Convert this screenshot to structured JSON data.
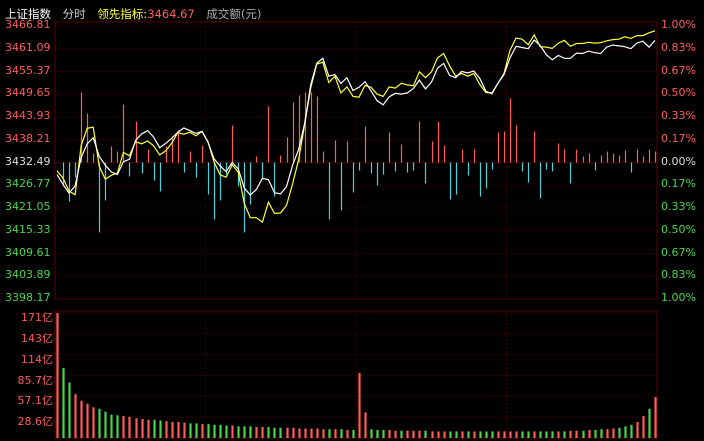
{
  "header": {
    "index_name": "上证指数",
    "period": "分时",
    "leading_index_label": "领先指标:",
    "leading_index_value": "3464.67",
    "volume_label": "成交额(元)"
  },
  "colors": {
    "background": "#000000",
    "up": "#ff5b5b",
    "down": "#4ad0d6",
    "even": "#dddddd",
    "green_pct": "#4bd44b",
    "price_line": "#ffffff",
    "leading_line": "#ffff33",
    "grid": "#3a0000"
  },
  "price_axis": {
    "left_labels": [
      "3466.81",
      "3461.09",
      "3455.37",
      "3449.65",
      "3443.93",
      "3438.21",
      "3432.49",
      "3426.77",
      "3421.05",
      "3415.33",
      "3409.61",
      "3403.89",
      "3398.17"
    ],
    "right_labels": [
      "1.00%",
      "0.83%",
      "0.67%",
      "0.50%",
      "0.33%",
      "0.17%",
      "0.00%",
      "0.17%",
      "0.33%",
      "0.50%",
      "0.67%",
      "0.83%",
      "1.00%"
    ]
  },
  "volume_axis": {
    "labels": [
      "171亿",
      "143亿",
      "114亿",
      "85.7亿",
      "57.1亿",
      "28.6亿"
    ]
  },
  "chart_data": {
    "type": "line",
    "prev_close": 3432.49,
    "ylim": [
      3398.17,
      3466.81
    ],
    "volume_ylim": [
      0,
      171
    ],
    "series": [
      {
        "name": "上证指数",
        "values": [
          3429.5,
          3427.0,
          3424.8,
          3426.6,
          3433.8,
          3437.2,
          3438.7,
          3434.0,
          3431.8,
          3430.1,
          3429.5,
          3432.7,
          3433.3,
          3438.0,
          3439.7,
          3440.5,
          3438.9,
          3436.2,
          3437.3,
          3438.6,
          3440.1,
          3441.2,
          3440.5,
          3439.8,
          3440.3,
          3437.6,
          3433.4,
          3431.6,
          3430.2,
          3432.5,
          3430.9,
          3426.1,
          3424.3,
          3425.7,
          3428.5,
          3428.2,
          3424.9,
          3424.6,
          3426.4,
          3431.8,
          3435.7,
          3442.4,
          3452.0,
          3457.4,
          3458.7,
          3454.2,
          3454.6,
          3452.4,
          3453.8,
          3450.6,
          3451.4,
          3452.8,
          3450.5,
          3448.0,
          3447.0,
          3449.0,
          3449.9,
          3449.7,
          3450.0,
          3451.1,
          3453.2,
          3451.0,
          3452.7,
          3456.2,
          3457.4,
          3454.4,
          3453.8,
          3455.4,
          3455.0,
          3455.5,
          3453.6,
          3450.4,
          3449.8,
          3452.4,
          3454.6,
          3458.8,
          3461.7,
          3461.4,
          3461.1,
          3463.3,
          3461.9,
          3459.6,
          3458.3,
          3459.4,
          3458.7,
          3458.7,
          3460.0,
          3459.9,
          3460.5,
          3460.1,
          3459.9,
          3461.5,
          3462.0,
          3461.8,
          3461.6,
          3461.1,
          3462.5,
          3463.0,
          3461.5,
          3463.2
        ]
      },
      {
        "name": "领先指标",
        "values": [
          3430.4,
          3428.6,
          3425.3,
          3424.4,
          3436.8,
          3441.1,
          3441.4,
          3431.5,
          3428.3,
          3429.3,
          3429.8,
          3435.0,
          3434.2,
          3437.7,
          3437.2,
          3437.9,
          3436.7,
          3434.4,
          3435.4,
          3437.4,
          3440.0,
          3439.6,
          3440.1,
          3439.2,
          3440.3,
          3437.7,
          3432.6,
          3429.4,
          3428.8,
          3431.9,
          3430.1,
          3422.2,
          3418.6,
          3418.6,
          3417.5,
          3422.5,
          3419.7,
          3419.8,
          3421.7,
          3427.1,
          3433.2,
          3442.1,
          3451.2,
          3457.2,
          3457.7,
          3452.6,
          3454.2,
          3450.0,
          3451.5,
          3449.1,
          3448.9,
          3451.9,
          3451.4,
          3449.7,
          3449.1,
          3451.5,
          3451.2,
          3452.4,
          3452.0,
          3451.8,
          3455.3,
          3453.8,
          3455.3,
          3458.8,
          3459.9,
          3456.8,
          3454.2,
          3454.9,
          3454.2,
          3454.9,
          3452.1,
          3450.1,
          3450.0,
          3452.4,
          3454.9,
          3460.7,
          3463.8,
          3463.5,
          3462.1,
          3464.6,
          3461.6,
          3461.5,
          3461.2,
          3462.5,
          3463.2,
          3461.7,
          3462.4,
          3462.4,
          3462.7,
          3462.5,
          3462.6,
          3463.1,
          3463.4,
          3463.5,
          3464.1,
          3463.7,
          3464.4,
          3464.4,
          3465.1,
          3465.6
        ]
      }
    ],
    "volume": [
      171,
      96,
      76,
      60,
      51,
      47,
      42,
      40,
      36,
      32,
      31,
      30,
      29,
      27,
      26,
      25,
      25,
      24,
      23,
      22,
      22,
      21,
      20,
      20,
      19,
      19,
      18,
      18,
      17,
      17,
      16,
      16,
      16,
      15,
      15,
      15,
      14,
      14,
      14,
      14,
      13,
      13,
      13,
      13,
      12,
      12,
      12,
      12,
      11,
      11,
      89,
      35,
      12,
      11,
      11,
      11,
      10,
      10,
      10,
      10,
      10,
      10,
      9,
      9,
      9,
      9,
      9,
      9,
      9,
      9,
      9,
      9,
      9,
      9,
      9,
      9,
      9,
      9,
      9,
      9,
      9,
      9,
      9,
      9,
      9,
      10,
      10,
      10,
      11,
      11,
      12,
      12,
      13,
      14,
      16,
      18,
      22,
      30,
      40,
      56
    ]
  }
}
